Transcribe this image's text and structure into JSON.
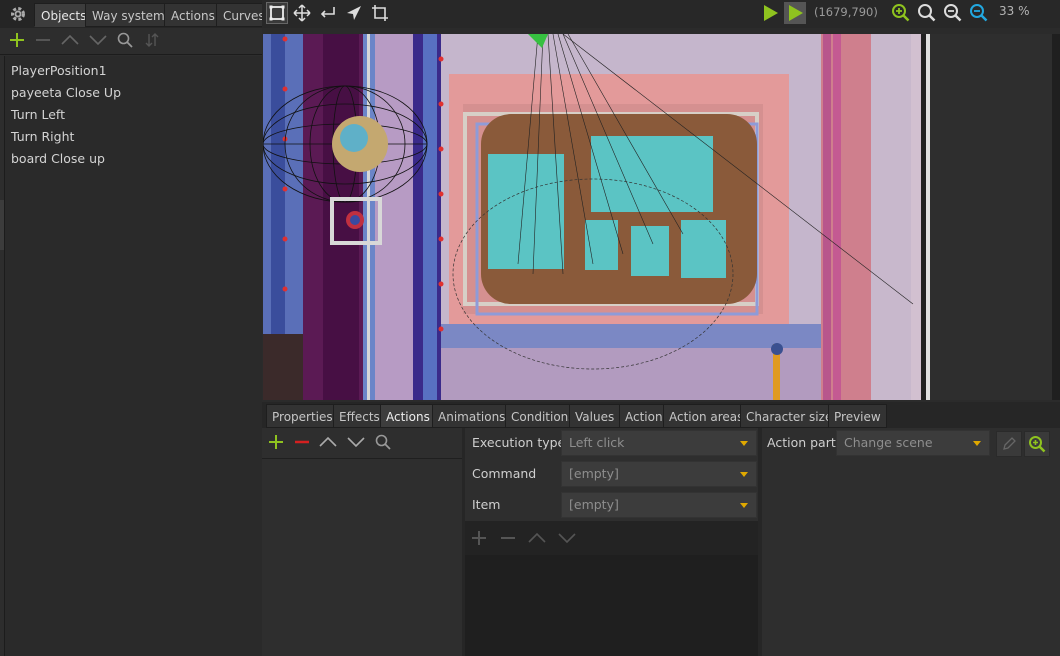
{
  "left_panel": {
    "tabs": [
      "Objects",
      "Way systems",
      "Actions",
      "Curves"
    ],
    "active_tab": "Objects",
    "objects": [
      "PlayerPosition1",
      "payeeta Close Up",
      "Turn Left",
      "Turn Right",
      "board Close up"
    ]
  },
  "toolbar": {
    "coordinates": "(1679,790)",
    "zoom": "33 %"
  },
  "bottom_tabs": [
    "Properties",
    "Effects",
    "Actions",
    "Animations",
    "Conditions",
    "Values",
    "Action",
    "Action areas",
    "Character size",
    "Preview"
  ],
  "active_bottom_tab": "Actions",
  "action_form": {
    "execution_type_label": "Execution type",
    "execution_type_value": "Left click",
    "command_label": "Command",
    "command_value": "[empty]",
    "item_label": "Item",
    "item_value": "[empty]"
  },
  "action_part": {
    "label": "Action part",
    "value": "Change scene"
  },
  "colors": {
    "accent_green": "#8fc31f",
    "accent_yellow": "#e0a800",
    "remove_red": "#d42020",
    "zoom_blue": "#22a8e0"
  }
}
